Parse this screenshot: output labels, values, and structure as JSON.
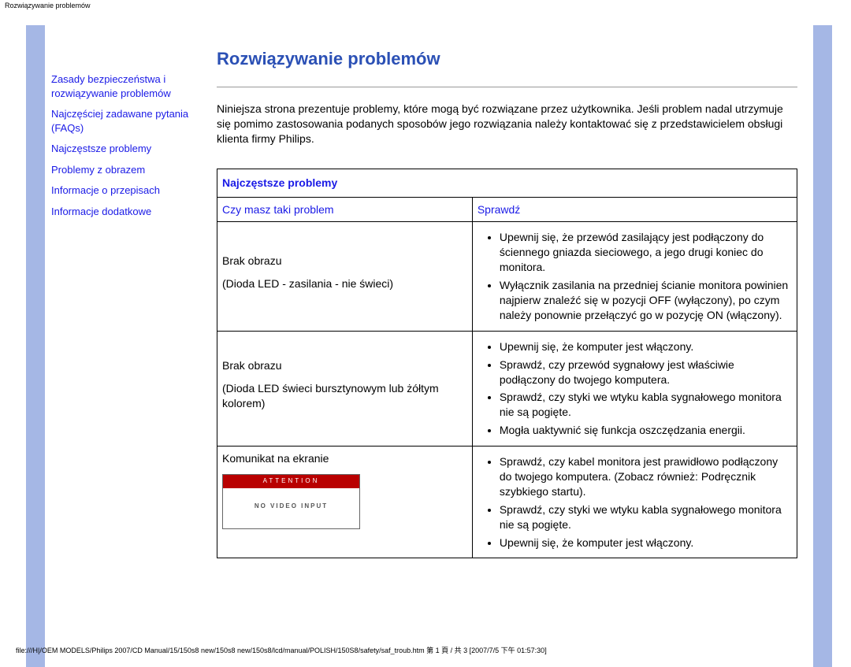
{
  "page_path": "Rozwiązywanie problemów",
  "sidebar": {
    "items": [
      {
        "label": "Zasady bezpieczeństwa i rozwiązywanie problemów"
      },
      {
        "label": "Najczęściej zadawane pytania (FAQs)"
      },
      {
        "label": "Najczęstsze problemy"
      },
      {
        "label": "Problemy z obrazem"
      },
      {
        "label": "Informacje o przepisach"
      },
      {
        "label": "Informacje dodatkowe"
      }
    ]
  },
  "main": {
    "title": "Rozwiązywanie problemów",
    "intro": "Niniejsza strona prezentuje problemy, które mogą być rozwiązane przez użytkownika. Jeśli problem nadal utrzymuje się pomimo zastosowania podanych sposobów jego rozwiązania należy kontaktować się z przedstawicielem obsługi klienta firmy Philips."
  },
  "table": {
    "section_heading": "Najczęstsze problemy",
    "col1": "Czy masz taki problem",
    "col2": "Sprawdź",
    "rows": [
      {
        "problem_lines": [
          "Brak obrazu",
          "(Dioda LED - zasilania - nie świeci)"
        ],
        "checks": [
          "Upewnij się, że przewód zasilający jest podłączony do ściennego gniazda sieciowego, a jego drugi koniec do monitora.",
          "Wyłącznik zasilania na przedniej ścianie monitora powinien najpierw znaleźć się w pozycji OFF (wyłączony), po czym należy ponownie przełączyć go w pozycję ON (włączony)."
        ]
      },
      {
        "problem_lines": [
          "Brak obrazu",
          "(Dioda LED świeci bursztynowym lub żółtym kolorem)"
        ],
        "checks": [
          "Upewnij się, że komputer jest włączony.",
          "Sprawdź, czy przewód sygnałowy jest właściwie podłączony do twojego komputera.",
          "Sprawdź, czy styki we wtyku kabla sygnałowego monitora nie są pogięte.",
          "Mogła uaktywnić się funkcja oszczędzania energii."
        ]
      },
      {
        "problem_lines": [
          "Komunikat na ekranie"
        ],
        "msgbox": {
          "attention": "ATTENTION",
          "body": "NO VIDEO INPUT"
        },
        "checks": [
          "Sprawdź, czy kabel monitora jest prawidłowo podłączony do twojego komputera. (Zobacz również: Podręcznik szybkiego startu).",
          "Sprawdź, czy styki we wtyku kabla sygnałowego monitora nie są pogięte.",
          "Upewnij się, że komputer jest włączony."
        ]
      }
    ]
  },
  "footer": "file:///H|/OEM MODELS/Philips 2007/CD Manual/15/150s8 new/150s8 new/150s8/lcd/manual/POLISH/150S8/safety/saf_troub.htm 第 1 頁 / 共 3  [2007/7/5 下午 01:57:30]"
}
